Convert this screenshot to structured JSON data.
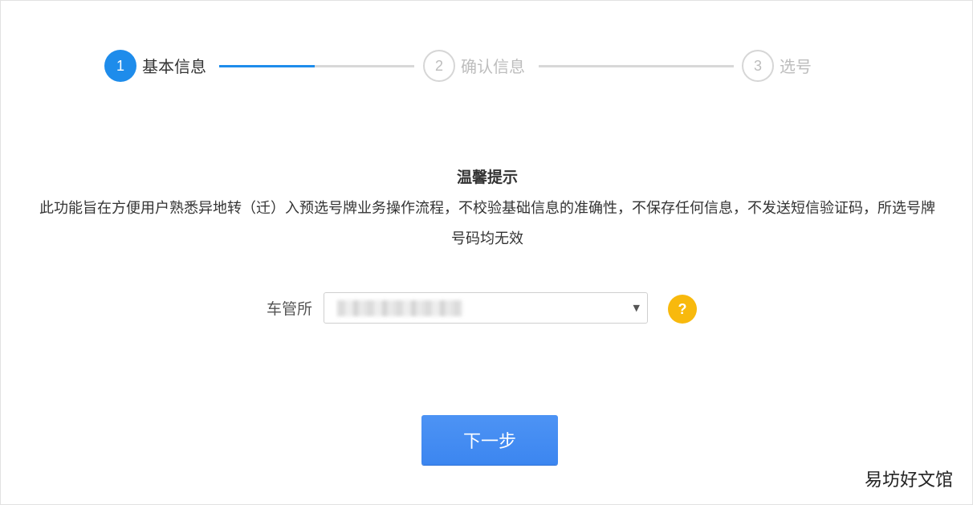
{
  "steps": [
    {
      "number": "1",
      "label": "基本信息",
      "state": "active"
    },
    {
      "number": "2",
      "label": "确认信息",
      "state": "inactive"
    },
    {
      "number": "3",
      "label": "选号",
      "state": "inactive"
    }
  ],
  "progress": {
    "connector_1_fill_fraction": 0.49,
    "connector_2_fill_fraction": 0
  },
  "notice": {
    "title": "温馨提示",
    "body": "此功能旨在方便用户熟悉异地转（迁）入预选号牌业务操作流程，不校验基础信息的准确性，不保存任何信息，不发送短信验证码，所选号牌号码均无效"
  },
  "form": {
    "office_label": "车管所",
    "office_value": "",
    "help_symbol": "?"
  },
  "actions": {
    "next_label": "下一步"
  },
  "watermark": "易坊好文馆",
  "colors": {
    "accent": "#1e8ceb",
    "button": "#4089f2",
    "help": "#f8b90d",
    "inactive": "#bdbdbd"
  },
  "icons": {
    "select_caret": "caret-down-icon",
    "help": "question-icon"
  }
}
